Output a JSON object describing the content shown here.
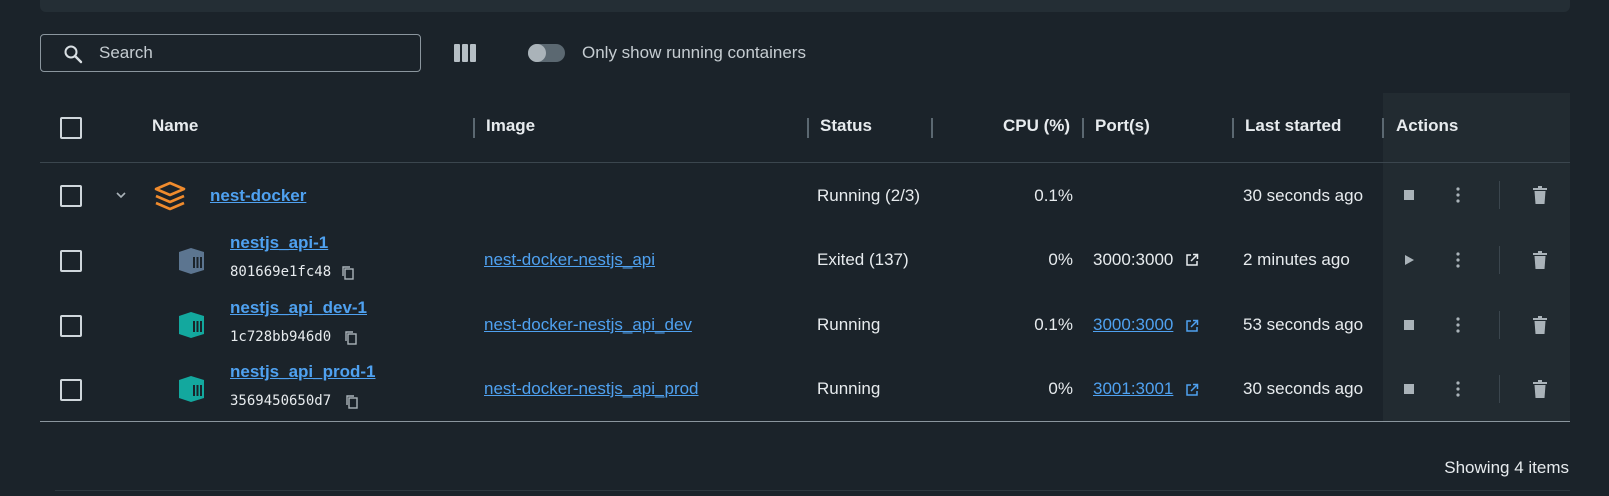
{
  "search": {
    "placeholder": "Search",
    "value": ""
  },
  "filter": {
    "toggle_label": "Only show running containers",
    "toggle_on": false
  },
  "columns": {
    "name": "Name",
    "image": "Image",
    "status": "Status",
    "cpu": "CPU (%)",
    "ports": "Port(s)",
    "last_started": "Last started",
    "actions": "Actions"
  },
  "group": {
    "name": "nest-docker",
    "status": "Running (2/3)",
    "cpu": "0.1%",
    "last_started": "30 seconds ago",
    "icon": "stack-icon",
    "color": "#f08b2d"
  },
  "containers": [
    {
      "name": "nestjs_api-1",
      "id": "801669e1fc48",
      "image": "nest-docker-nestjs_api",
      "status": "Exited (137)",
      "cpu": "0%",
      "port": "3000:3000",
      "port_link": false,
      "last_started": "2 minutes ago",
      "state": "exited"
    },
    {
      "name": "nestjs_api_dev-1",
      "id": "1c728bb946d0",
      "image": "nest-docker-nestjs_api_dev",
      "status": "Running",
      "cpu": "0.1%",
      "port": "3000:3000",
      "port_link": true,
      "last_started": "53 seconds ago",
      "state": "running"
    },
    {
      "name": "nestjs_api_prod-1",
      "id": "3569450650d7",
      "image": "nest-docker-nestjs_api_prod",
      "status": "Running",
      "cpu": "0%",
      "port": "3001:3001",
      "port_link": true,
      "last_started": "30 seconds ago",
      "state": "running"
    }
  ],
  "footer": {
    "count_text": "Showing 4 items"
  },
  "colors": {
    "running": "#13a89e",
    "exited": "#5c7590",
    "link": "#4fa1f0",
    "background": "#1b232a"
  }
}
